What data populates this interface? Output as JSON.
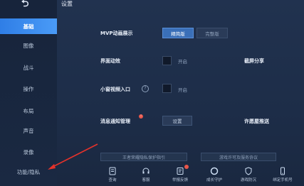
{
  "header": {
    "back_icon": "back-arrow-icon",
    "title": "设置"
  },
  "sidebar": {
    "items": [
      {
        "label": "基础",
        "active": true
      },
      {
        "label": "图像"
      },
      {
        "label": "战斗"
      },
      {
        "label": "操作"
      },
      {
        "label": "布局"
      },
      {
        "label": "声音"
      },
      {
        "label": "录像"
      },
      {
        "label": "功能/隐私"
      }
    ]
  },
  "settings": {
    "mvp": {
      "label": "MVP动画展示",
      "option_selected": "精简版",
      "option_other": "完整版"
    },
    "interface_animation": {
      "label": "界面动效",
      "toggle_label": "开启"
    },
    "screenshot_share": {
      "label": "截屏分享"
    },
    "mini_video": {
      "label": "小窗视频入口",
      "toggle_label": "开启"
    },
    "notification": {
      "label": "消息通知管理",
      "badge": "!",
      "button_label": "设置"
    },
    "permission_push": {
      "label": "许愿屋推送"
    },
    "privacy_guide": {
      "label": "王者荣耀隐私保护指引"
    },
    "license_agreement": {
      "label": "游戏许可及服务协议"
    }
  },
  "bottom_bar": {
    "items": [
      {
        "label": "查询",
        "icon": "search-icon"
      },
      {
        "label": "客服",
        "icon": "headset-icon"
      },
      {
        "label": "举报反馈",
        "icon": "report-icon",
        "badge": true
      },
      {
        "label": "成长守护",
        "icon": "ring-icon"
      },
      {
        "label": "游戏防沉",
        "icon": "shield-icon"
      },
      {
        "label": "绑定手机号",
        "icon": "phone-icon"
      }
    ]
  },
  "colors": {
    "sidebar_active": "#3b8af0",
    "background": "#1d2d48",
    "badge_red": "#e8564a",
    "annotation_arrow": "#e3322b"
  }
}
